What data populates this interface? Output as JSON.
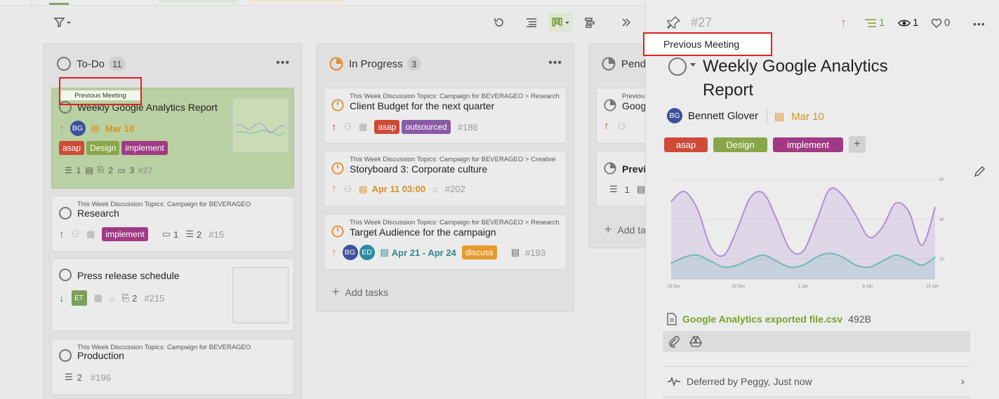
{
  "toolbar": {
    "filter_icon": "filter-icon",
    "undo_icon": "undo-icon",
    "list_icon": "list-view-icon",
    "board_icon": "board-view-icon",
    "gantt_icon": "gantt-view-icon",
    "collapse_icon": "double-chevron-right-icon"
  },
  "columns": [
    {
      "title": "To-Do",
      "count": "11"
    },
    {
      "title": "In Progress",
      "count": "3"
    },
    {
      "title": "Pend"
    }
  ],
  "todo_cards": [
    {
      "title": "Weekly Google Analytics Report",
      "avatar": "BG",
      "date": "Mar 10",
      "tags": [
        "asap",
        "Design",
        "implement"
      ],
      "subtasks": "1",
      "attachments": "2",
      "comments": "3",
      "number": "#27"
    },
    {
      "crumb": "This Week Discussion Topics: Campaign for BEVERAGEO",
      "title": "Research",
      "tags": [
        "implement"
      ],
      "comments": "1",
      "subtasks": "2",
      "number": "#15"
    },
    {
      "title": "Press release schedule",
      "avatar": "ET",
      "attachments": "2",
      "number": "#215"
    },
    {
      "crumb": "This Week Discussion Topics: Campaign for BEVERAGEO",
      "title": "Production",
      "subtasks": "2",
      "number": "#196"
    }
  ],
  "progress_cards": [
    {
      "crumb": "This Week Discussion Topics: Campaign for BEVERAGEO > Research",
      "title": "Client Budget for the next quarter",
      "tags": [
        "asap",
        "outsourced"
      ],
      "number": "#186"
    },
    {
      "crumb": "This Week Discussion Topics: Campaign for BEVERAGEO > Creative",
      "title": "Storyboard 3: Corporate culture",
      "date": "Apr 11  03:00",
      "number": "#202"
    },
    {
      "crumb": "This Week Discussion Topics: Campaign for BEVERAGEO > Research",
      "title": "Target Audience for the campaign",
      "avatars": [
        "BG",
        "ED"
      ],
      "date": "Apr 21 - Apr 24",
      "tags": [
        "discuss"
      ],
      "number": "#193"
    }
  ],
  "add_tasks": "Add tasks",
  "pending_cards": [
    {
      "crumb": "Previou",
      "title": "Goog"
    },
    {
      "title": "Previ"
    }
  ],
  "pending_add": "Add ta",
  "tooltip_small": "Previous Meeting",
  "detail": {
    "number": "#27",
    "subtasks_count": "1",
    "watchers_count": "1",
    "likes_count": "0",
    "tooltip": "Previous Meeting",
    "title_line1": "Weekly Google Analytics",
    "title_line2": "Report",
    "assignee_initials": "BG",
    "assignee": "Bennett Glover",
    "date": "Mar 10",
    "tags": [
      "asap",
      "Design",
      "implement"
    ],
    "add_tag": "+",
    "attachment_name": "Google Analytics exported file.csv",
    "attachment_size": "492B",
    "activity": "Deferred by Peggy, Just now"
  },
  "colors": {
    "asap": "#cf4a37",
    "design": "#8aa64a",
    "implement": "#a13a85",
    "outsourced": "#8a5aa6",
    "discuss": "#e49a2c",
    "accent_green": "#7ba02e",
    "orange": "#d9911d"
  },
  "chart_data": {
    "type": "area",
    "x_ticks": [
      "18 Dec",
      "25 Dec",
      "1 Jan",
      "8 Jan",
      "15 Jan"
    ],
    "y_ticks": [
      "20",
      "40",
      "60"
    ],
    "ylim": [
      10,
      60
    ],
    "grid": true,
    "series": [
      {
        "color": "#b08fd6",
        "x": [
          0,
          0.5,
          1,
          1.5,
          2,
          2.5,
          3,
          3.5,
          4,
          4.5,
          5,
          5.5,
          6,
          6.5,
          7,
          7.5,
          8,
          8.5,
          9,
          9.5,
          10
        ],
        "values": [
          49,
          54,
          45,
          26,
          22,
          35,
          51,
          53,
          40,
          25,
          24,
          39,
          55,
          52,
          42,
          31,
          36,
          48,
          44,
          27,
          46
        ]
      },
      {
        "color": "#5ec4b6",
        "x": [
          0,
          0.5,
          1,
          1.5,
          2,
          2.5,
          3,
          3.5,
          4,
          4.5,
          5,
          5.5,
          6,
          6.5,
          7,
          7.5,
          8,
          8.5,
          9,
          9.5,
          10
        ],
        "values": [
          18,
          21,
          22,
          19,
          16,
          17,
          20,
          22,
          19,
          16,
          17,
          21,
          23,
          21,
          17,
          16,
          19,
          22,
          20,
          17,
          21
        ]
      }
    ]
  }
}
